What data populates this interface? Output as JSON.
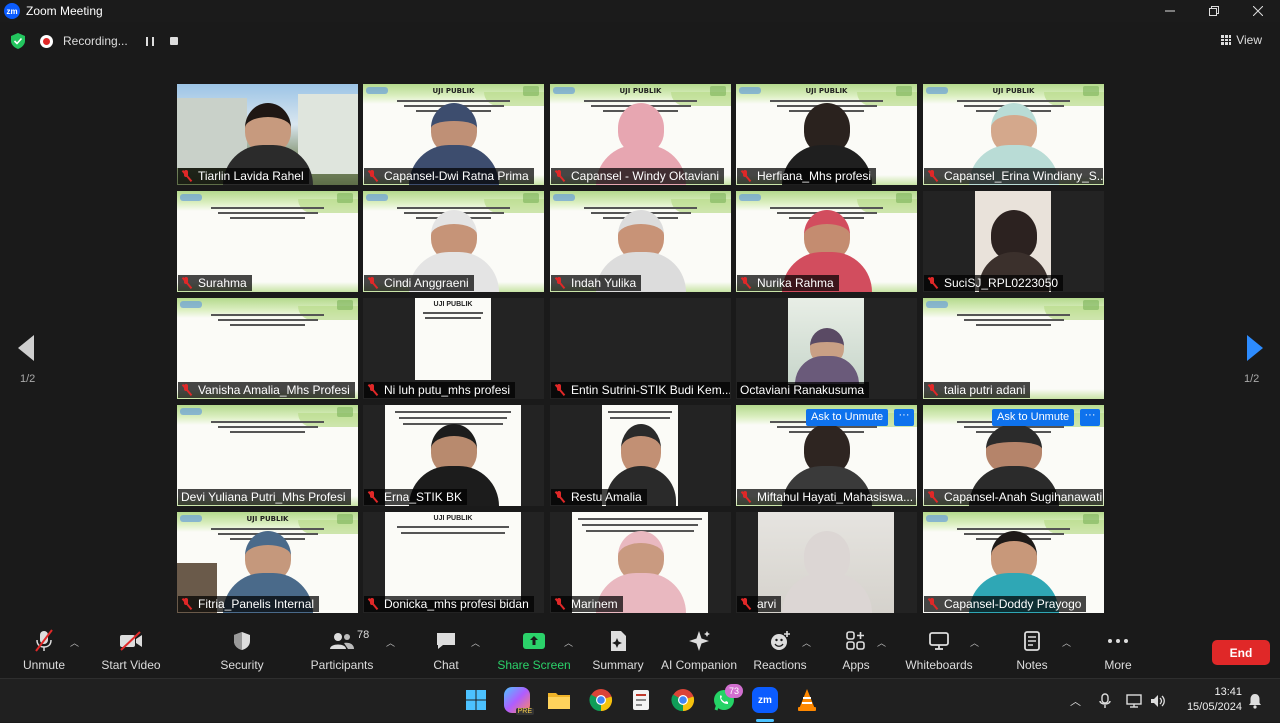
{
  "window": {
    "title": "Zoom Meeting",
    "logo_text": "zm"
  },
  "recording": {
    "status_text": "Recording..."
  },
  "view": {
    "label": "View"
  },
  "pagination": {
    "left_page": "1/2",
    "right_page": "1/2"
  },
  "slide_title": "UJI PUBLIK",
  "ask_to_unmute_label": "Ask to Unmute",
  "more_dots": "···",
  "participants": [
    {
      "name": "Tiarlin Lavida Rahel"
    },
    {
      "name": "Capansel-Dwi Ratna Prima"
    },
    {
      "name": "Capansel - Windy Oktaviani"
    },
    {
      "name": "Herfiana_Mhs profesi"
    },
    {
      "name": "Capansel_Erina Windiany_S..."
    },
    {
      "name": "Surahma"
    },
    {
      "name": "Cindi Anggraeni"
    },
    {
      "name": "Indah Yulika"
    },
    {
      "name": "Nurika Rahma"
    },
    {
      "name": "SuciSJ_RPL0223050"
    },
    {
      "name": "Vanisha Amalia_Mhs Profesi"
    },
    {
      "name": "Ni luh putu_mhs profesi"
    },
    {
      "name": "Entin Sutrini-STIK Budi Kem..."
    },
    {
      "name": "Octaviani Ranakusuma"
    },
    {
      "name": "talia putri adani"
    },
    {
      "name": "Devi Yuliana Putri_Mhs Profesi"
    },
    {
      "name": "Erna_STIK BK"
    },
    {
      "name": "Restu Amalia"
    },
    {
      "name": "Miftahul Hayati_Mahasiswa..."
    },
    {
      "name": "Capansel-Anah Sugihanawati"
    },
    {
      "name": "Fitria_Panelis Internal"
    },
    {
      "name": "Donicka_mhs profesi bidan"
    },
    {
      "name": "Marinem"
    },
    {
      "name": "arvi"
    },
    {
      "name": "Capansel-Doddy Prayogo"
    }
  ],
  "toolbar": {
    "unmute": "Unmute",
    "start_video": "Start Video",
    "security": "Security",
    "participants": "Participants",
    "participant_count": "78",
    "chat": "Chat",
    "share_screen": "Share Screen",
    "summary": "Summary",
    "ai_companion": "AI Companion",
    "reactions": "Reactions",
    "apps": "Apps",
    "whiteboards": "Whiteboards",
    "notes": "Notes",
    "more": "More",
    "end": "End"
  },
  "taskbar": {
    "whatsapp_badge": "73",
    "copilot_badge": "PRE",
    "zoom_icon_text": "zm",
    "time": "13:41",
    "date": "15/05/2024"
  },
  "colors": {
    "accent_blue": "#0e72ed",
    "end_red": "#e02828",
    "share_green": "#2bd26a"
  }
}
